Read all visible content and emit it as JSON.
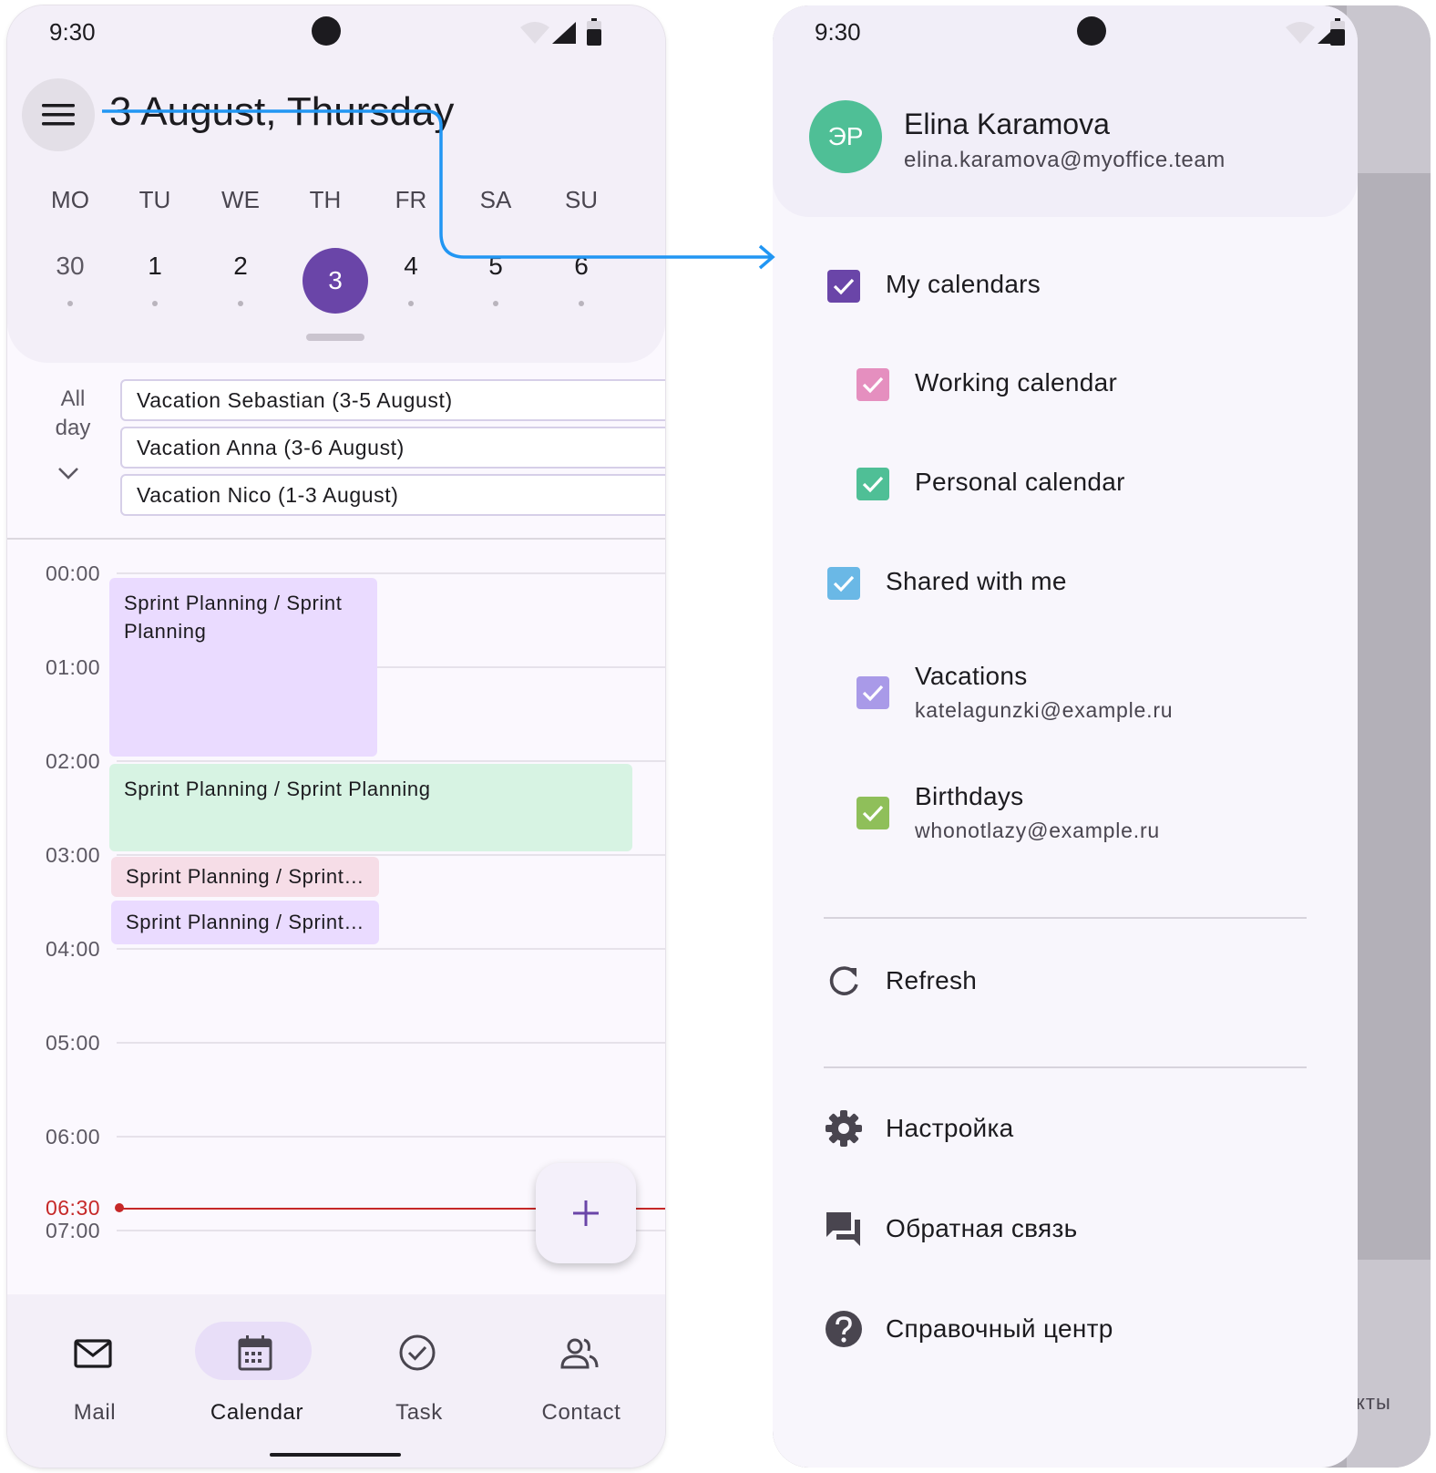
{
  "status_bar": {
    "time": "9:30"
  },
  "left": {
    "date_title": "3 August, Thursday",
    "weekdays": [
      "MO",
      "TU",
      "WE",
      "TH",
      "FR",
      "SA",
      "SU"
    ],
    "days": [
      "30",
      "1",
      "2",
      "3",
      "4",
      "5",
      "6"
    ],
    "selected_day_index": 3,
    "all_day": {
      "label_line1": "All",
      "label_line2": "day",
      "events": [
        "Vacation Sebastian (3-5 August)",
        "Vacation Anna (3-6 August)",
        "Vacation Nico (1-3 August)"
      ]
    },
    "times": [
      "00:00",
      "01:00",
      "02:00",
      "03:00",
      "04:00",
      "05:00",
      "06:00",
      "07:00"
    ],
    "now_time": "06:30",
    "events": [
      {
        "title": "Sprint Planning  / Sprint Planning",
        "color": "#eadbff"
      },
      {
        "title": "Sprint Planning / Sprint Planning",
        "color": "#d7f3e3"
      },
      {
        "title": "Sprint Planning / Sprint…",
        "color": "#f6dde7"
      },
      {
        "title": "Sprint Planning / Sprint…",
        "color": "#eadbff"
      }
    ],
    "fab_icon": "plus-icon",
    "nav": [
      {
        "label": "Mail",
        "icon": "mail-icon",
        "active": false
      },
      {
        "label": "Calendar",
        "icon": "calendar-icon",
        "active": true
      },
      {
        "label": "Task",
        "icon": "check-circle-icon",
        "active": false
      },
      {
        "label": "Contact",
        "icon": "contacts-icon",
        "active": false
      }
    ]
  },
  "drawer": {
    "avatar_initials": "ЭР",
    "user_name": "Elina Karamova",
    "user_email": "elina.karamova@myoffice.team",
    "groups": {
      "my_calendars": {
        "label": "My calendars",
        "color": "#6a45a8"
      },
      "working": {
        "label": "Working calendar",
        "color": "#e58fbf"
      },
      "personal": {
        "label": "Personal calendar",
        "color": "#4fbf96"
      },
      "shared": {
        "label": "Shared with me",
        "color": "#6ab8e6"
      },
      "vacations": {
        "label": "Vacations",
        "sub": "katelagunzki@example.ru",
        "color": "#a99ae8"
      },
      "birthdays": {
        "label": "Birthdays",
        "sub": "whonotlazy@example.ru",
        "color": "#8fbf5a"
      }
    },
    "refresh": "Refresh",
    "settings": "Настройка",
    "feedback": "Обратная связь",
    "help": "Справочный центр",
    "peek_text": "кты"
  }
}
